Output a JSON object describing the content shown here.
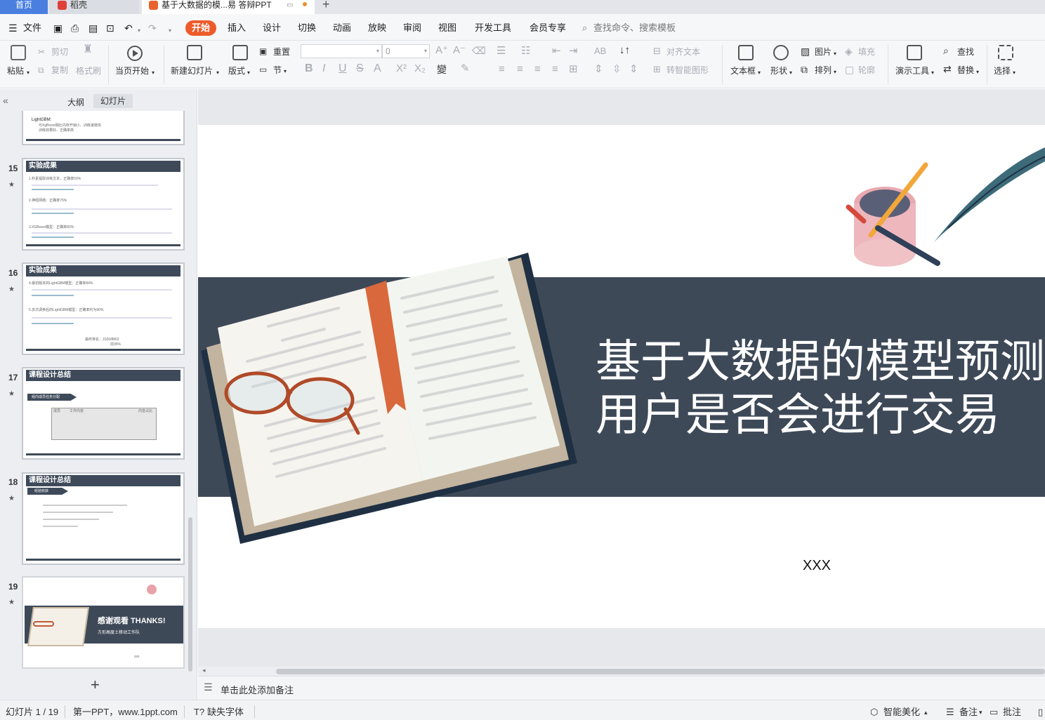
{
  "tabs": {
    "home": "首页",
    "daoke": "稻壳",
    "doc": "基于大数据的模...易 答辩PPT"
  },
  "menu": {
    "file": "文件",
    "items": [
      "开始",
      "插入",
      "设计",
      "切换",
      "动画",
      "放映",
      "审阅",
      "视图",
      "开发工具",
      "会员专享"
    ],
    "search_placeholder": "查找命令、搜索模板"
  },
  "ribbon": {
    "paste": "粘贴",
    "cut": "剪切",
    "copy": "复制",
    "format_painter": "格式刷",
    "from_current": "当页开始",
    "new_slide": "新建幻灯片",
    "layout": "版式",
    "reset": "重置",
    "section": "节",
    "font_size": "0",
    "align_text": "对齐文本",
    "smart_graphic": "转智能图形",
    "textbox": "文本框",
    "shape": "形状",
    "picture": "图片",
    "arrange": "排列",
    "fill": "填充",
    "outline": "轮廓",
    "present_tool": "演示工具",
    "find": "查找",
    "replace": "替换",
    "select": "选择"
  },
  "panel": {
    "outline_tab": "大纲",
    "slides_tab": "幻灯片"
  },
  "thumbnails": [
    {
      "num": "",
      "title": "",
      "lines": [
        "LightGBM:",
        "与XgBoost相比内存开销小、训练速度快",
        "训练效果好、正确率高"
      ]
    },
    {
      "num": "15",
      "title": "实验成果",
      "lines": [
        "1.朴素提取训练文本，正确率50%",
        "2.神经网络：正确率75%",
        "3.XGBoost模型：正确率80%"
      ]
    },
    {
      "num": "16",
      "title": "实验成果",
      "lines": [
        "4.最初版本的LightGBM模型：正确率84%",
        "5.多次调参后的LightGBM模型：正确率约为90%",
        "最终排名：3100/8802",
        "前35%"
      ]
    },
    {
      "num": "17",
      "title": "课程设计总结",
      "lines": [
        "组内成员任务分配",
        "成员",
        "工作内容",
        "内容占比"
      ]
    },
    {
      "num": "18",
      "title": "课程设计总结",
      "lines": [
        "经验收获"
      ]
    },
    {
      "num": "19",
      "title": "",
      "lines": [
        "感谢观看 THANKS!",
        "方形高度土移动工作队",
        "xxx"
      ]
    }
  ],
  "slide": {
    "title_line1": "基于大数据的模型预测",
    "title_line2": "用户是否会进行交易",
    "author": "XXX"
  },
  "notes_placeholder": "单击此处添加备注",
  "status": {
    "slide_counter": "幻灯片 1 / 19",
    "theme": "第一PPT，www.1ppt.com",
    "missing_font": "缺失字体",
    "smart_beautify": "智能美化",
    "notes": "备注",
    "comments": "批注"
  },
  "colors": {
    "accent": "#ee5b2a",
    "band": "#3e4958",
    "home_tab": "#4a7fe0"
  }
}
